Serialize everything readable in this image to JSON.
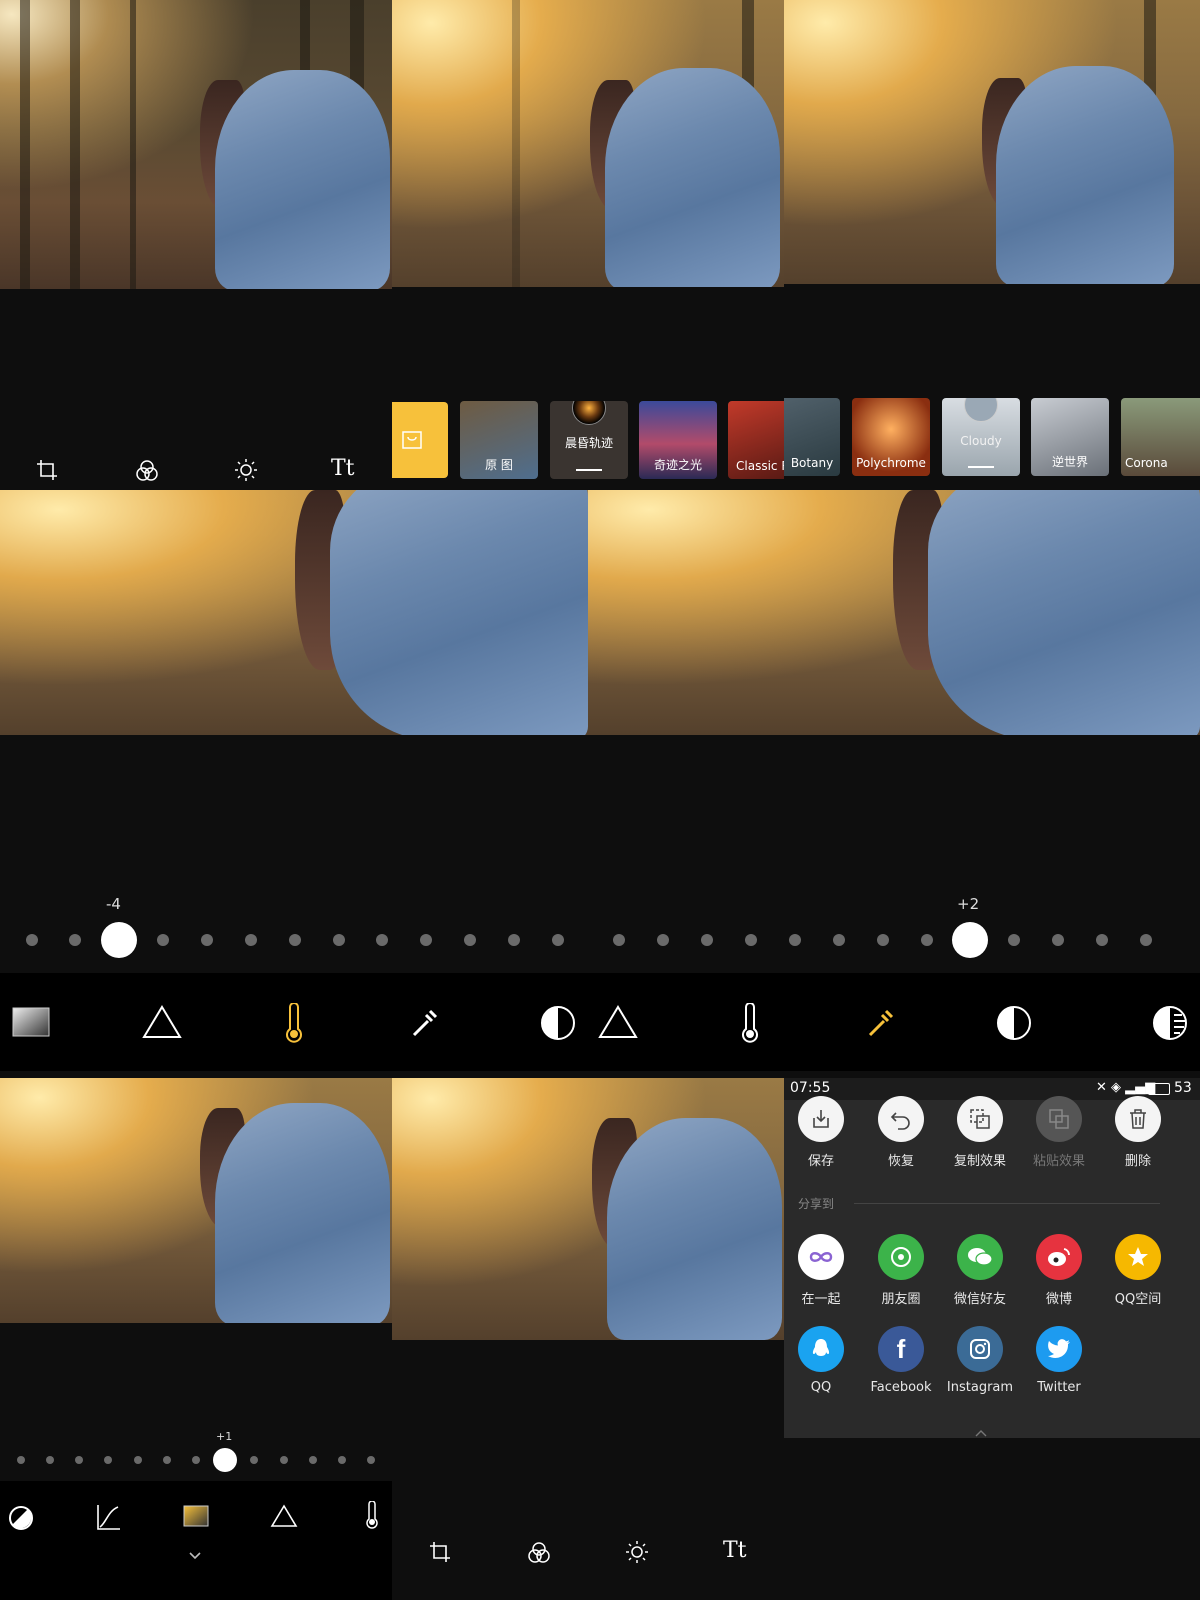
{
  "panel2": {
    "filters": [
      "原 图",
      "晨昏轨迹",
      "奇迹之光",
      "Classic R"
    ]
  },
  "panel3": {
    "filters": [
      "Botany",
      "Polychrome",
      "Cloudy",
      "逆世界",
      "Corona"
    ]
  },
  "panel4": {
    "value": "-4",
    "level": -4
  },
  "panel5": {
    "value": "+2",
    "level": 2
  },
  "panel7": {
    "value": "+1",
    "level": 1
  },
  "status": {
    "time": "07:55",
    "battery": "53"
  },
  "actions": [
    {
      "label": "保存",
      "icon": "save-icon"
    },
    {
      "label": "恢复",
      "icon": "undo-icon"
    },
    {
      "label": "复制效果",
      "icon": "copy-icon"
    },
    {
      "label": "粘贴效果",
      "icon": "paste-icon"
    },
    {
      "label": "删除",
      "icon": "delete-icon"
    }
  ],
  "share_heading": "分享到",
  "share_row1": [
    {
      "label": "在一起",
      "icon": "together-icon",
      "color": "#ffffff"
    },
    {
      "label": "朋友圈",
      "icon": "moments-icon",
      "color": "#3cb34a"
    },
    {
      "label": "微信好友",
      "icon": "wechat-icon",
      "color": "#3cb34a"
    },
    {
      "label": "微博",
      "icon": "weibo-icon",
      "color": "#e6333f"
    },
    {
      "label": "QQ空间",
      "icon": "qzone-icon",
      "color": "#f6b800"
    }
  ],
  "share_row2": [
    {
      "label": "QQ",
      "icon": "qq-icon",
      "color": "#1aa3f0"
    },
    {
      "label": "Facebook",
      "icon": "facebook-icon",
      "color": "#3a5998"
    },
    {
      "label": "Instagram",
      "icon": "instagram-icon",
      "color": "#3b6b96"
    },
    {
      "label": "Twitter",
      "icon": "twitter-icon",
      "color": "#1d9bf0"
    }
  ],
  "colors": {
    "accent": "#f7c13b",
    "panel": "#2a2a2a",
    "background": "#0e0e0e"
  }
}
